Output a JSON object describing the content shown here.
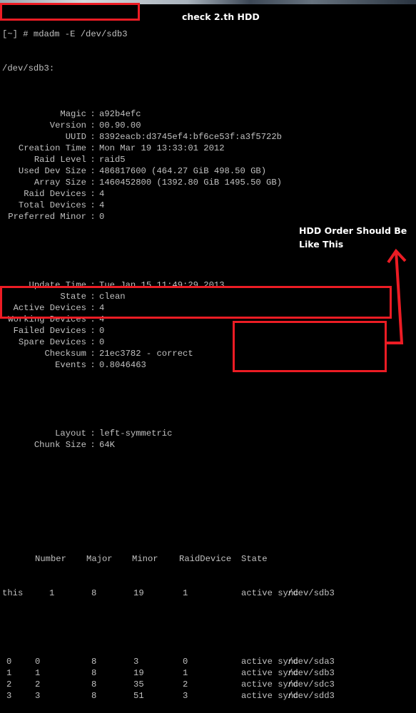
{
  "window": {
    "title_strip": "terminal window titlebar (partially visible)"
  },
  "terminal": {
    "prompt": "[~] # ",
    "command": "mdadm -E /dev/sdb3",
    "device_header": "/dev/sdb3:",
    "fields_1": [
      {
        "key": "Magic",
        "value": "a92b4efc"
      },
      {
        "key": "Version",
        "value": "00.90.00"
      },
      {
        "key": "UUID",
        "value": "8392eacb:d3745ef4:bf6ce53f:a3f5722b"
      },
      {
        "key": "Creation Time",
        "value": "Mon Mar 19 13:33:01 2012"
      },
      {
        "key": "Raid Level",
        "value": "raid5"
      },
      {
        "key": "Used Dev Size",
        "value": "486817600 (464.27 GiB 498.50 GB)"
      },
      {
        "key": "Array Size",
        "value": "1460452800 (1392.80 GiB 1495.50 GB)"
      },
      {
        "key": "Raid Devices",
        "value": "4"
      },
      {
        "key": "Total Devices",
        "value": "4"
      },
      {
        "key": "Preferred Minor",
        "value": "0"
      }
    ],
    "fields_2": [
      {
        "key": "Update Time",
        "value": "Tue Jan 15 11:49:29 2013"
      },
      {
        "key": "State",
        "value": "clean"
      },
      {
        "key": "Active Devices",
        "value": "4"
      },
      {
        "key": "Working Devices",
        "value": "4"
      },
      {
        "key": "Failed Devices",
        "value": "0"
      },
      {
        "key": "Spare Devices",
        "value": "0"
      },
      {
        "key": "Checksum",
        "value": "21ec3782 - correct"
      },
      {
        "key": "Events",
        "value": "0.8046463"
      }
    ],
    "fields_3": [
      {
        "key": "Layout",
        "value": "left-symmetric"
      },
      {
        "key": "Chunk Size",
        "value": "64K"
      }
    ],
    "table": {
      "headers": [
        "",
        "Number",
        "Major",
        "Minor",
        "RaidDevice",
        "State",
        ""
      ],
      "this_row": [
        "this",
        "1",
        "8",
        "19",
        "1",
        "active sync",
        "/dev/sdb3"
      ],
      "rows": [
        [
          "0",
          "0",
          "8",
          "3",
          "0",
          "active sync",
          "/dev/sda3"
        ],
        [
          "1",
          "1",
          "8",
          "19",
          "1",
          "active sync",
          "/dev/sdb3"
        ],
        [
          "2",
          "2",
          "8",
          "35",
          "2",
          "active sync",
          "/dev/sdc3"
        ],
        [
          "3",
          "3",
          "8",
          "51",
          "3",
          "active sync",
          "/dev/sdd3"
        ]
      ]
    }
  },
  "annotations": {
    "check_label": "check 2.th HDD",
    "order_label_line1": "HDD Order Should Be",
    "order_label_line2": "Like This",
    "highlight_color": "#ec1c24"
  }
}
